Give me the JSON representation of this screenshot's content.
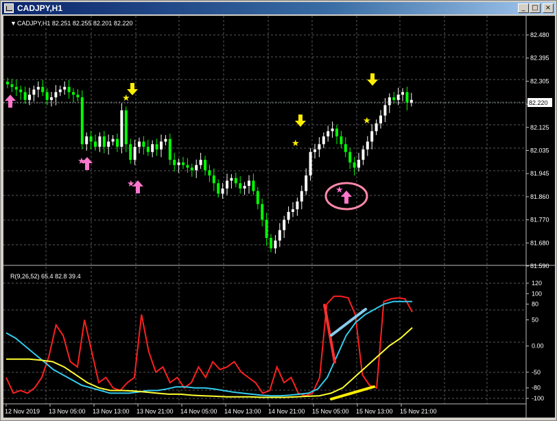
{
  "window": {
    "title": "CADJPY,H1",
    "buttons": {
      "minimize": "_",
      "maximize": "□",
      "close": "×"
    }
  },
  "chart": {
    "header": "CADJPY,H1  82.251 82.255 82.201 82.220",
    "current_price_label": "82.220",
    "price_axis_labels": [
      "82.480",
      "82.395",
      "82.305",
      "82.215",
      "82.125",
      "82.035",
      "81.945",
      "81.860",
      "81.770",
      "81.680",
      "81.590"
    ],
    "time_axis_labels": [
      "12 Nov 2019",
      "13 Nov 05:00",
      "13 Nov 13:00",
      "13 Nov 21:00",
      "14 Nov 05:00",
      "14 Nov 13:00",
      "14 Nov 21:00",
      "15 Nov 05:00",
      "15 Nov 13:00",
      "15 Nov 21:00"
    ]
  },
  "indicator": {
    "header": "R(9,26,52) 65.4 82.8 39.4",
    "axis_labels": [
      "120",
      "100",
      "80",
      "50",
      "0.00",
      "-50",
      "-80",
      "-100"
    ]
  },
  "colors": {
    "bull_candle": "#ffffff",
    "bear_candle": "#00ff00",
    "line_fast": "#ff2020",
    "line_mid": "#33ccee",
    "line_slow": "#ffff33",
    "arrow_down": "#ffee00",
    "arrow_up": "#ff77cc",
    "annotation_red": "#ff3030",
    "annotation_blue": "#88ccee",
    "annotation_yellow": "#ffee00",
    "highlight_ellipse": "#ff88aa"
  },
  "chart_data": {
    "type": "candlestick",
    "symbol": "CADJPY",
    "timeframe": "H1",
    "price_range": [
      81.59,
      82.48
    ],
    "ohlc_last": {
      "open": 82.251,
      "high": 82.255,
      "low": 82.201,
      "close": 82.22
    },
    "close_approx": [
      82.28,
      82.27,
      82.26,
      82.25,
      82.22,
      82.24,
      82.26,
      82.27,
      82.25,
      82.22,
      82.23,
      82.25,
      82.26,
      82.27,
      82.25,
      82.24,
      82.23,
      82.05,
      82.08,
      82.06,
      82.04,
      82.08,
      82.04,
      82.06,
      82.07,
      82.04,
      82.18,
      82.05,
      81.99,
      82.04,
      82.06,
      82.04,
      82.02,
      82.05,
      82.03,
      82.06,
      82.07,
      81.99,
      81.97,
      81.98,
      81.97,
      81.96,
      81.95,
      81.97,
      81.99,
      81.95,
      81.93,
      81.9,
      81.86,
      81.88,
      81.91,
      81.92,
      81.9,
      81.88,
      81.89,
      81.91,
      81.87,
      81.82,
      81.76,
      81.69,
      81.65,
      81.68,
      81.72,
      81.76,
      81.79,
      81.8,
      81.83,
      81.87,
      81.93,
      82.02,
      82.03,
      82.05,
      82.08,
      82.1,
      82.11,
      82.08,
      82.05,
      82.02,
      81.98,
      81.96,
      81.99,
      82.03,
      82.06,
      82.1,
      82.13,
      82.16,
      82.2,
      82.23,
      82.22,
      82.24,
      82.25,
      82.21,
      82.22
    ],
    "indicator": {
      "name": "R(9,26,52)",
      "values": [
        65.4,
        82.8,
        39.4
      ],
      "range": [
        -100,
        120
      ],
      "series": [
        {
          "name": "R9",
          "values": [
            -60,
            -90,
            -85,
            -90,
            -80,
            -60,
            -20,
            40,
            20,
            -30,
            -40,
            50,
            -10,
            -70,
            -60,
            -80,
            -85,
            -70,
            -60,
            60,
            -10,
            -50,
            -40,
            -70,
            -60,
            -80,
            -70,
            -40,
            -60,
            -30,
            -45,
            -40,
            -30,
            -50,
            -60,
            -70,
            -90,
            -85,
            -40,
            -70,
            -60,
            -90,
            -95,
            -90,
            -60,
            80,
            95,
            95,
            92,
            60,
            -55,
            -75,
            -80,
            85,
            90,
            92,
            90,
            65
          ]
        },
        {
          "name": "R26",
          "values": [
            25,
            15,
            0,
            -15,
            -30,
            -45,
            -55,
            -65,
            -75,
            -80,
            -85,
            -90,
            -90,
            -90,
            -88,
            -85,
            -85,
            -82,
            -78,
            -78,
            -80,
            -80,
            -82,
            -85,
            -88,
            -90,
            -92,
            -94,
            -95,
            -95,
            -94,
            -92,
            -90,
            -82,
            -60,
            -20,
            20,
            45,
            60,
            70,
            80,
            85,
            85,
            85
          ]
        },
        {
          "name": "R52",
          "values": [
            -25,
            -25,
            -25,
            -27,
            -30,
            -40,
            -55,
            -70,
            -80,
            -85,
            -85,
            -86,
            -88,
            -90,
            -92,
            -92,
            -94,
            -95,
            -96,
            -97,
            -97,
            -97,
            -98,
            -98,
            -98,
            -97,
            -96,
            -95,
            -90,
            -80,
            -60,
            -40,
            -20,
            0,
            15,
            35
          ]
        }
      ]
    }
  }
}
